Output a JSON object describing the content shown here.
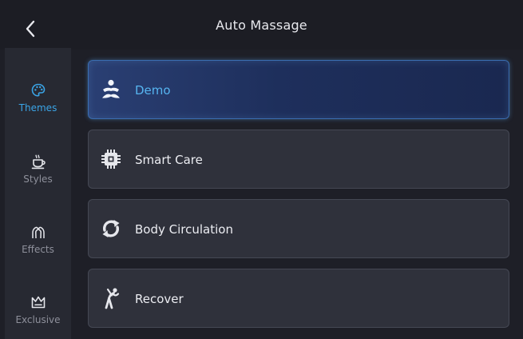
{
  "header": {
    "title": "Auto Massage",
    "back_icon": "chevron-left-icon"
  },
  "sidebar": {
    "items": [
      {
        "label": "Themes",
        "icon": "palette-icon",
        "active": true
      },
      {
        "label": "Styles",
        "icon": "cup-icon",
        "active": false
      },
      {
        "label": "Effects",
        "icon": "muscle-arms-icon",
        "active": false
      },
      {
        "label": "Exclusive",
        "icon": "crown-icon",
        "active": false
      }
    ]
  },
  "programs": [
    {
      "label": "Demo",
      "icon": "person-meditation-icon",
      "active": true
    },
    {
      "label": "Smart Care",
      "icon": "chip-icon",
      "active": false
    },
    {
      "label": "Body Circulation",
      "icon": "circular-arrows-icon",
      "active": false
    },
    {
      "label": "Recover",
      "icon": "stretching-person-icon",
      "active": false
    }
  ],
  "colors": {
    "accent": "#3aa4e6",
    "background": "#1e1f27",
    "sidebar": "#272932",
    "card": "#2f313b",
    "active_card": "#1e2f5c"
  }
}
